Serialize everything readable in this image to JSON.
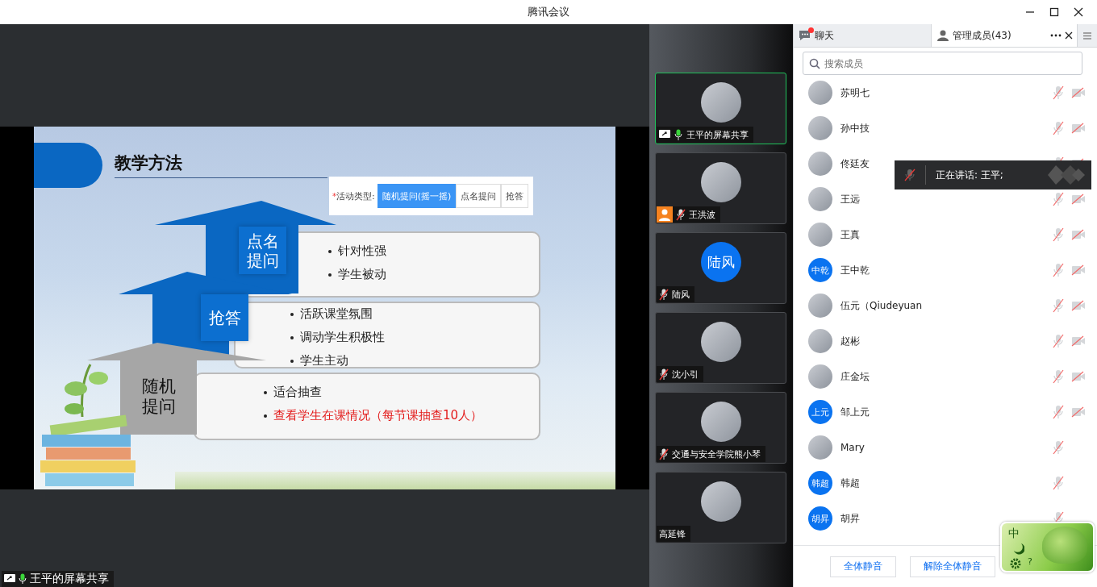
{
  "window": {
    "title": "腾讯会议"
  },
  "share": {
    "label": "王平的屏幕共享",
    "mic_on": true
  },
  "slide": {
    "title": "教学方法",
    "form": {
      "required_mark": "*",
      "label": "活动类型:",
      "options": [
        {
          "label": "随机提问(摇一摇)",
          "selected": true
        },
        {
          "label": "点名提问",
          "selected": false
        },
        {
          "label": "抢答",
          "selected": false
        }
      ]
    },
    "steps": [
      {
        "label": "点名提问",
        "color": "#0a67c2",
        "points": [
          {
            "text": "针对性强",
            "emphasis": false
          },
          {
            "text": "学生被动",
            "emphasis": false
          }
        ]
      },
      {
        "label": "抢答",
        "color": "#0a67c2",
        "points": [
          {
            "text": "活跃课堂氛围",
            "emphasis": false
          },
          {
            "text": "调动学生积极性",
            "emphasis": false
          },
          {
            "text": "学生主动",
            "emphasis": false
          }
        ]
      },
      {
        "label": "随机提问",
        "color": "#a6a6a6",
        "points": [
          {
            "text": "适合抽查",
            "emphasis": false
          },
          {
            "text": "查看学生在课情况（每节课抽查10人）",
            "emphasis": true
          }
        ]
      }
    ]
  },
  "tiles": [
    {
      "name": "王平的屏幕共享",
      "avatar": {
        "kind": "photo"
      },
      "mic_on": true,
      "mic_muted": false,
      "sharing": true,
      "user_badge": false,
      "focused": true
    },
    {
      "name": "王洪波",
      "avatar": {
        "kind": "photo"
      },
      "mic_on": false,
      "mic_muted": true,
      "sharing": false,
      "user_badge": true,
      "focused": false
    },
    {
      "name": "陆风",
      "avatar": {
        "kind": "initials",
        "text": "陆风"
      },
      "mic_on": false,
      "mic_muted": true,
      "sharing": false,
      "user_badge": false,
      "focused": false
    },
    {
      "name": "沈小引",
      "avatar": {
        "kind": "photo"
      },
      "mic_on": false,
      "mic_muted": true,
      "sharing": false,
      "user_badge": false,
      "focused": false
    },
    {
      "name": "交通与安全学院熊小琴",
      "avatar": {
        "kind": "photo"
      },
      "mic_on": false,
      "mic_muted": true,
      "sharing": false,
      "user_badge": false,
      "focused": false
    },
    {
      "name": "高延锋",
      "avatar": {
        "kind": "photo"
      },
      "mic_on": false,
      "mic_muted": false,
      "sharing": false,
      "user_badge": false,
      "focused": false
    }
  ],
  "panel": {
    "tabs": [
      {
        "label": "聊天",
        "selected": false,
        "unread": true
      },
      {
        "label": "管理成员(43)",
        "selected": true
      }
    ],
    "search": {
      "placeholder": "搜索成员"
    },
    "members": [
      {
        "name": "苏明七",
        "avatar": {
          "kind": "photo"
        },
        "mic_muted": true,
        "camera_off": true
      },
      {
        "name": "孙中技",
        "avatar": {
          "kind": "photo"
        },
        "mic_muted": true,
        "camera_off": true
      },
      {
        "name": "佟廷友",
        "avatar": {
          "kind": "photo"
        },
        "mic_muted": true,
        "camera_off": true
      },
      {
        "name": "王远",
        "avatar": {
          "kind": "photo"
        },
        "mic_muted": true,
        "camera_off": true
      },
      {
        "name": "王真",
        "avatar": {
          "kind": "photo"
        },
        "mic_muted": true,
        "camera_off": true
      },
      {
        "name": "王中乾",
        "avatar": {
          "kind": "initials",
          "text": "中乾"
        },
        "mic_muted": true,
        "camera_off": true
      },
      {
        "name": "伍元（Qiudeyuan",
        "avatar": {
          "kind": "photo"
        },
        "mic_muted": true,
        "camera_off": true
      },
      {
        "name": "赵彬",
        "avatar": {
          "kind": "photo"
        },
        "mic_muted": true,
        "camera_off": true
      },
      {
        "name": "庄金坛",
        "avatar": {
          "kind": "photo"
        },
        "mic_muted": true,
        "camera_off": true
      },
      {
        "name": "邹上元",
        "avatar": {
          "kind": "initials",
          "text": "上元"
        },
        "mic_muted": true,
        "camera_off": true
      },
      {
        "name": "Mary",
        "avatar": {
          "kind": "photo"
        },
        "mic_muted": true,
        "camera_off": false
      },
      {
        "name": "韩超",
        "avatar": {
          "kind": "initials",
          "text": "韩超"
        },
        "mic_muted": true,
        "camera_off": false
      },
      {
        "name": "胡昇",
        "avatar": {
          "kind": "initials",
          "text": "胡昇"
        },
        "mic_muted": true,
        "camera_off": false
      }
    ],
    "speaking_toast": {
      "text": "正在讲话: 王平;"
    },
    "buttons": [
      "全体静音",
      "解除全体静音"
    ]
  },
  "ime": {
    "mode": "中",
    "help": "?"
  }
}
